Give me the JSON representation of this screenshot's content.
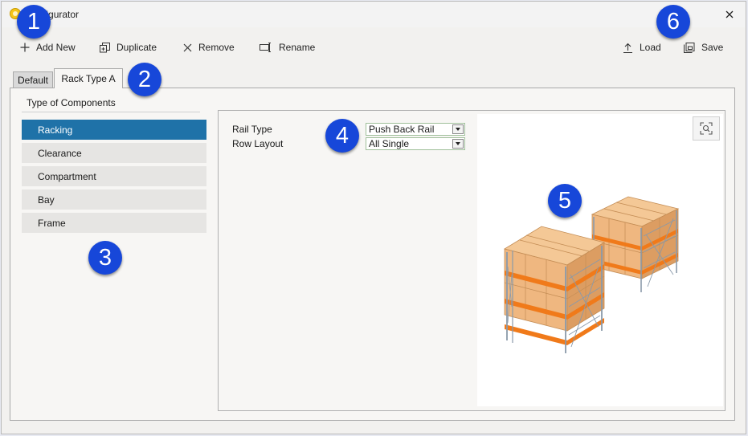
{
  "window": {
    "title": "Configurator"
  },
  "toolbar": {
    "add_new": "Add New",
    "duplicate": "Duplicate",
    "remove": "Remove",
    "rename": "Rename",
    "load": "Load",
    "save": "Save"
  },
  "tabs": [
    {
      "label": "Default"
    },
    {
      "label": "Rack Type A",
      "active": true
    }
  ],
  "components": {
    "title": "Type of Components",
    "items": [
      {
        "label": "Racking",
        "selected": true
      },
      {
        "label": "Clearance"
      },
      {
        "label": "Compartment"
      },
      {
        "label": "Bay"
      },
      {
        "label": "Frame"
      }
    ]
  },
  "properties": {
    "rail_type": {
      "label": "Rail Type",
      "value": "Push Back Rail"
    },
    "row_layout": {
      "label": "Row Layout",
      "value": "All Single"
    }
  },
  "annotations": [
    "1",
    "2",
    "3",
    "4",
    "5",
    "6"
  ],
  "colors": {
    "accent": "#1f72a8",
    "badge": "#1747d9",
    "beam": "#f07a1a",
    "box": "#f2c08c",
    "upright": "#8a9aaa"
  },
  "icons": {
    "app": "gear-icon",
    "close": "close-icon",
    "add": "plus-icon",
    "duplicate": "duplicate-icon",
    "remove": "x-icon",
    "rename": "rename-icon",
    "load": "upload-icon",
    "save": "save-icon",
    "zoom": "zoom-fit-icon"
  }
}
